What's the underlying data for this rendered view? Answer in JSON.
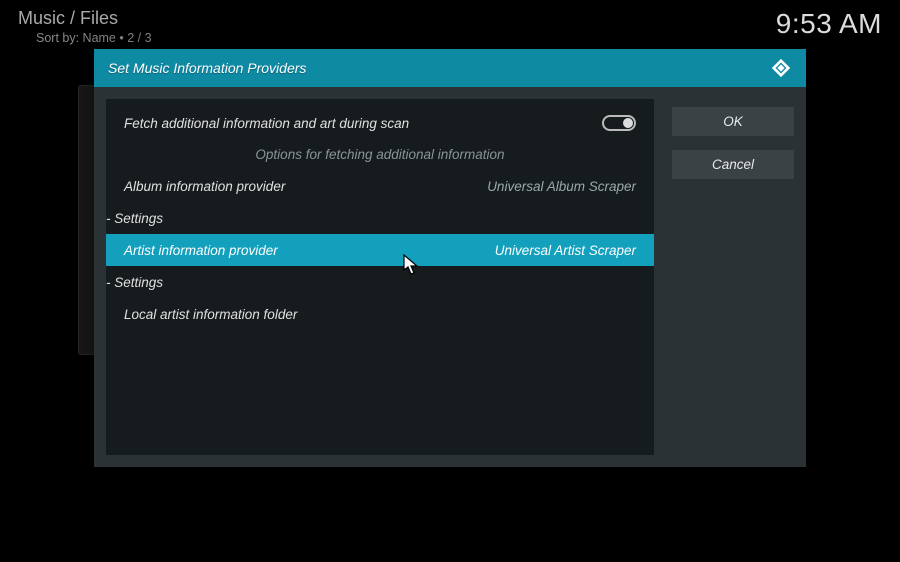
{
  "topbar": {
    "breadcrumb": "Music / Files",
    "sortline": "Sort by: Name  •  2 / 3",
    "clock": "9:53 AM"
  },
  "dialog": {
    "title": "Set Music Information Providers",
    "fetch_row": {
      "label": "Fetch additional information and art during scan"
    },
    "section_label": "Options for fetching additional information",
    "rows": {
      "album": {
        "label": "Album information provider",
        "value": "Universal Album Scraper"
      },
      "album_settings": {
        "label": "- Settings"
      },
      "artist": {
        "label": "Artist information provider",
        "value": "Universal Artist Scraper"
      },
      "artist_settings": {
        "label": "- Settings"
      },
      "local_folder": {
        "label": "Local artist information folder"
      }
    },
    "buttons": {
      "ok": "OK",
      "cancel": "Cancel"
    }
  }
}
